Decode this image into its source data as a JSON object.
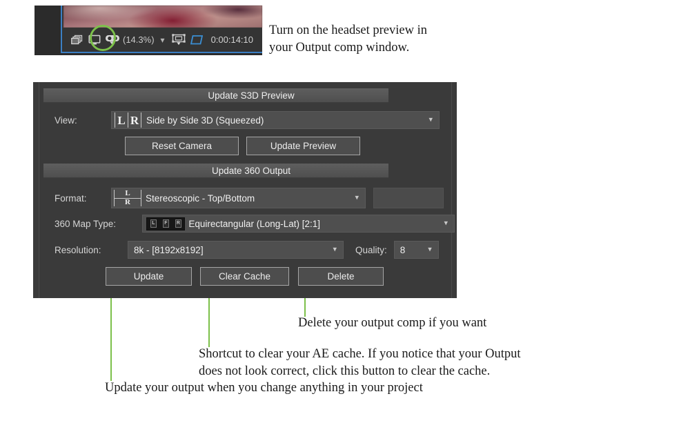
{
  "comp_viewer": {
    "zoom_label": "(14.3%)",
    "timecode": "0:00:14:10",
    "icons": {
      "snapshot": "snapshot-icon",
      "monitor": "monitor-icon",
      "headset": "headset-preview-icon",
      "chevron": "chevron-down-icon",
      "region_of_interest": "region-of-interest-icon",
      "transparency_grid": "transparency-grid-icon"
    }
  },
  "annotations": {
    "headset": "Turn on the headset preview in\nyour Output comp window.",
    "delete": "Delete your output comp if you want",
    "clear_cache": "Shortcut to clear your AE cache. If you notice that your Output\ndoes not look correct, click this button to clear the cache.",
    "update": "Update your output when you change anything in your project"
  },
  "panel": {
    "section_s3d_title": "Update S3D Preview",
    "section_360_title": "Update 360 Output",
    "view": {
      "label": "View:",
      "value": "Side by Side 3D (Squeezed)",
      "icon_left": "L",
      "icon_right": "R"
    },
    "reset_camera_label": "Reset Camera",
    "update_preview_label": "Update Preview",
    "format": {
      "label": "Format:",
      "value": "Stereoscopic - Top/Bottom",
      "icon_top": "L",
      "icon_bottom": "R"
    },
    "map_type": {
      "label": "360 Map Type:",
      "value": "Equirectangular (Long-Lat) [2:1]",
      "icon_cells": [
        "L",
        "F",
        "R"
      ]
    },
    "resolution": {
      "label": "Resolution:",
      "value": "8k - [8192x8192]"
    },
    "quality": {
      "label": "Quality:",
      "value": "8"
    },
    "update_label": "Update",
    "clear_cache_label": "Clear Cache",
    "delete_label": "Delete"
  },
  "colors": {
    "accent_green": "#7cc04a",
    "panel_bg": "#3a3a3a",
    "control_bg": "#4f4f4f",
    "viewer_blue": "#3b7fc4"
  }
}
